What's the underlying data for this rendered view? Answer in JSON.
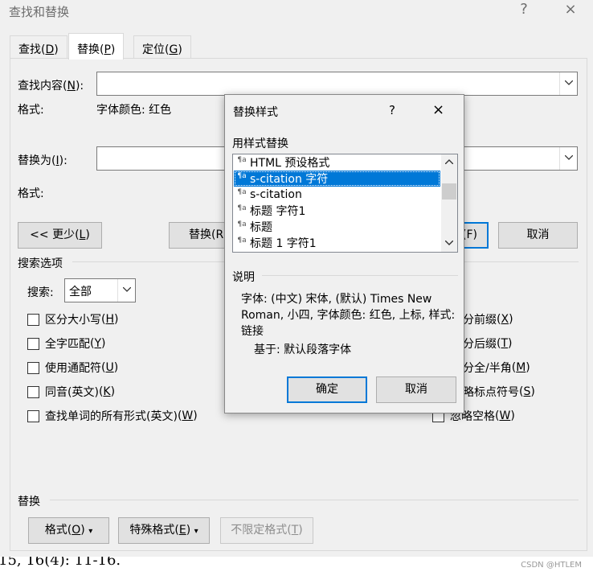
{
  "window": {
    "title": "查找和替换",
    "help": "?",
    "close": "×"
  },
  "tabs": [
    {
      "label": "查找",
      "key": "D"
    },
    {
      "label": "替换",
      "key": "P"
    },
    {
      "label": "定位",
      "key": "G"
    }
  ],
  "find": {
    "label": "查找内容",
    "key": "N",
    "value": "",
    "format_label": "格式:",
    "format_value": "字体颜色: 红色"
  },
  "replace": {
    "label": "替换为",
    "key": "I",
    "value": "",
    "format_label": "格式:"
  },
  "buttons": {
    "less": "<< 更少",
    "less_key": "L",
    "replace_partial": "替换(R",
    "find_next_partial": "(F)",
    "cancel": "取消"
  },
  "search_options": {
    "title": "搜索选项",
    "search_label": "搜索",
    "search_key": "",
    "search_value": "全部",
    "left_checks": [
      {
        "label": "区分大小写",
        "key": "H"
      },
      {
        "label": "全字匹配",
        "key": "Y"
      },
      {
        "label": "使用通配符",
        "key": "U"
      },
      {
        "label": "同音(英文)",
        "key": "K"
      },
      {
        "label": "查找单词的所有形式(英文)",
        "key": "W"
      }
    ],
    "right_checks": [
      {
        "label": "分前缀",
        "key": "X"
      },
      {
        "label": "分后缀",
        "key": "T"
      },
      {
        "label": "分全/半角",
        "key": "M"
      },
      {
        "label": "略标点符号",
        "key": "S"
      },
      {
        "label": "忽略空格",
        "key": "W"
      }
    ]
  },
  "replace_section": {
    "title": "替换",
    "format_button": "格式",
    "format_key": "O",
    "special_button": "特殊格式",
    "special_key": "E",
    "no_format_button": "不限定格式",
    "no_format_key": "T"
  },
  "background_doc_text": "15, 16(4): 11-16.",
  "watermark": "CSDN @HTLEM",
  "modal": {
    "title": "替换样式",
    "help": "?",
    "close": "×",
    "list_label": "用样式替换",
    "styles": [
      "HTML 预设格式",
      "s-citation 字符",
      "s-citation",
      "标题 字符1",
      "标题",
      "标题 1 字符1"
    ],
    "selected_index": 1,
    "desc_label": "说明",
    "description": "字体: (中文) 宋体, (默认) Times New Roman, 小四, 字体颜色: 红色, 上标, 样式: 链接",
    "based_on": "基于: 默认段落字体",
    "ok": "确定",
    "cancel": "取消"
  }
}
